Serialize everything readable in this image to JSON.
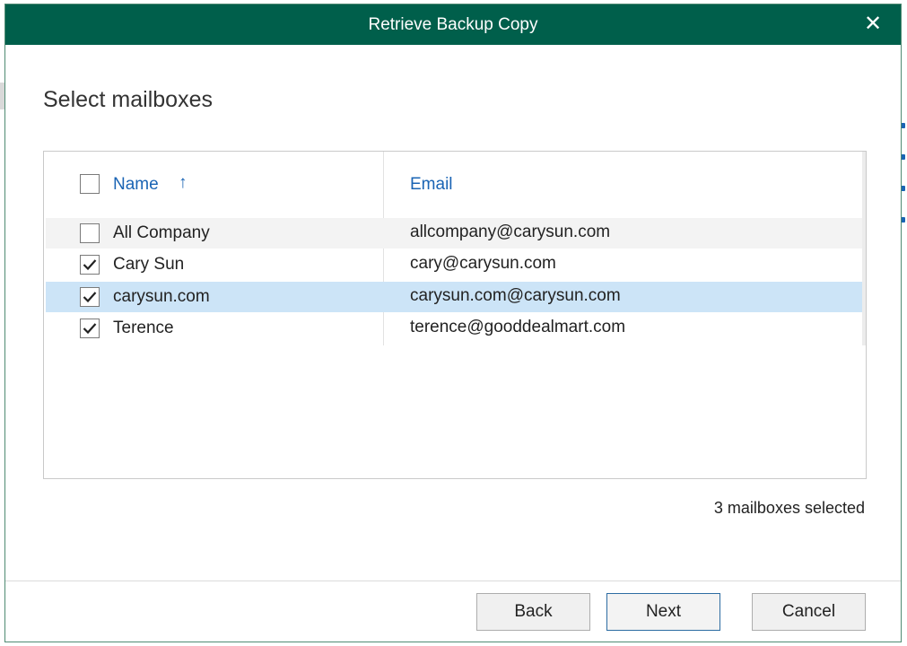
{
  "dialog": {
    "title": "Retrieve Backup Copy",
    "close_glyph": "✕"
  },
  "page": {
    "heading": "Select mailboxes"
  },
  "grid": {
    "columns": [
      "Name",
      "Email"
    ],
    "sort_column": "Name",
    "sort_direction": "ascending",
    "sort_glyph": "↑",
    "rows": [
      {
        "name": "All Company",
        "email": "allcompany@carysun.com",
        "checked": false,
        "selected": false
      },
      {
        "name": "Cary Sun",
        "email": "cary@carysun.com",
        "checked": true,
        "selected": false
      },
      {
        "name": "carysun.com",
        "email": "carysun.com@carysun.com",
        "checked": true,
        "selected": true
      },
      {
        "name": "Terence",
        "email": "terence@gooddealmart.com",
        "checked": true,
        "selected": false
      }
    ]
  },
  "status": {
    "selection_text": "3 mailboxes selected"
  },
  "footer": {
    "back_label": "Back",
    "next_label": "Next",
    "cancel_label": "Cancel"
  },
  "colors": {
    "titlebar": "#005f4b",
    "header_link": "#1a64b4",
    "selected_row": "#cce4f7",
    "alt_row": "#f3f3f3"
  }
}
